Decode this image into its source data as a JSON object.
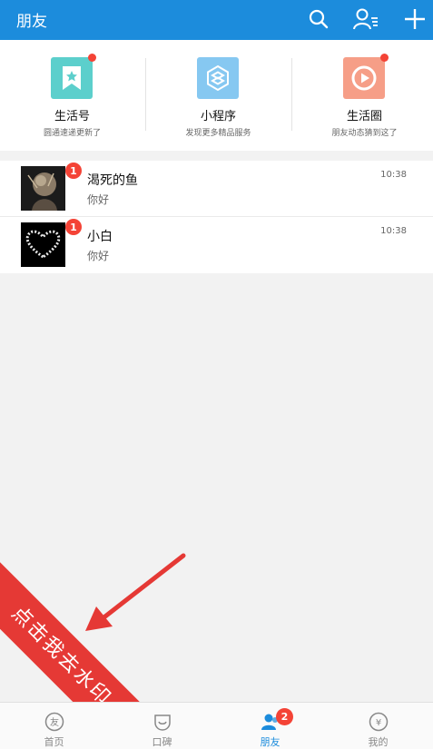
{
  "header": {
    "title": "朋友",
    "icons": [
      "search-icon",
      "contacts-icon",
      "add-icon"
    ]
  },
  "quick_actions": [
    {
      "label": "生活号",
      "subtitle": "圆通速递更新了",
      "icon": "bookmark-star-icon",
      "color": "#5ccfcc",
      "dot": true
    },
    {
      "label": "小程序",
      "subtitle": "发现更多精品服务",
      "icon": "miniprogram-icon",
      "color": "#86c8f1",
      "dot": false
    },
    {
      "label": "生活圈",
      "subtitle": "朋友动态猜到这了",
      "icon": "life-circle-icon",
      "color": "#f69e87",
      "dot": true
    }
  ],
  "conversations": [
    {
      "name": "渴死的鱼",
      "message": "你好",
      "time": "10:38",
      "unread": "1"
    },
    {
      "name": "小白",
      "message": "你好",
      "time": "10:38",
      "unread": "1"
    }
  ],
  "watermark": {
    "text": "点击我去水印",
    "color": "#e53935"
  },
  "tabbar": {
    "items": [
      {
        "label": "首页",
        "icon": "home-icon"
      },
      {
        "label": "口碑",
        "icon": "koubei-icon"
      },
      {
        "label": "朋友",
        "icon": "friends-icon",
        "badge": "2",
        "active": true
      },
      {
        "label": "我的",
        "icon": "profile-icon"
      }
    ]
  },
  "colors": {
    "accent": "#1c8cdc",
    "badge": "#f44336"
  }
}
